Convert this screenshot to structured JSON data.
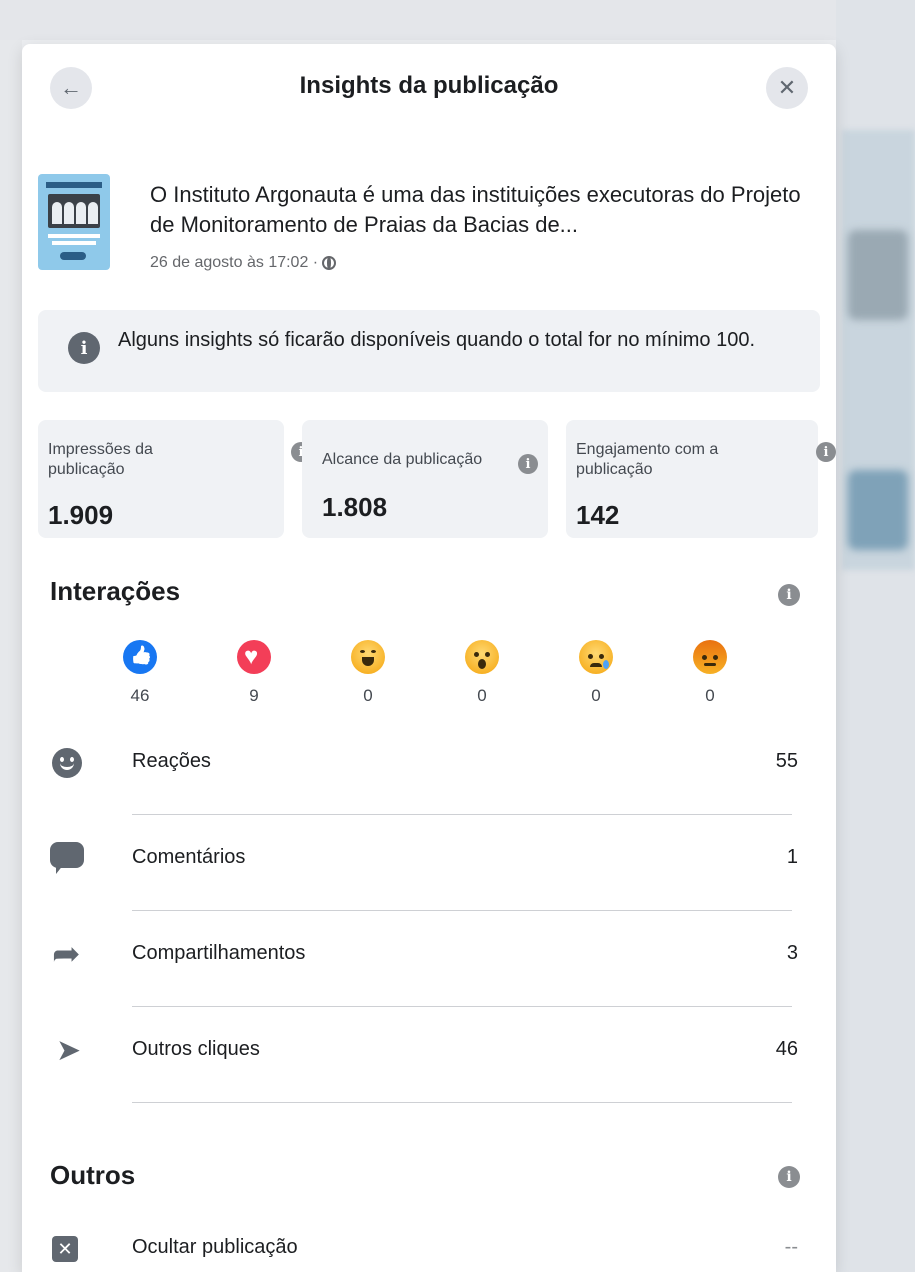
{
  "header": {
    "title": "Insights da publicação",
    "back_icon": "←",
    "close_icon": "✕"
  },
  "post": {
    "text": "O Instituto Argonauta é uma das instituições executoras do Projeto de Monitoramento de Praias da Bacias de...",
    "date": "26 de agosto às 17:02 ·"
  },
  "notice": {
    "text": "Alguns insights só ficarão disponíveis quando o total for no mínimo 100."
  },
  "metrics": [
    {
      "label": "Impressões da publicação",
      "value": "1.909"
    },
    {
      "label": "Alcance da publicação",
      "value": "1.808"
    },
    {
      "label": "Engajamento com a publicação",
      "value": "142"
    }
  ],
  "interactions": {
    "title": "Interações",
    "reactions": [
      {
        "type": "like",
        "icon": "like-icon",
        "count": "46"
      },
      {
        "type": "love",
        "icon": "love-icon",
        "count": "9"
      },
      {
        "type": "haha",
        "icon": "haha-icon",
        "count": "0"
      },
      {
        "type": "wow",
        "icon": "wow-icon",
        "count": "0"
      },
      {
        "type": "sad",
        "icon": "sad-icon",
        "count": "0"
      },
      {
        "type": "angry",
        "icon": "angry-icon",
        "count": "0"
      }
    ],
    "rows": [
      {
        "icon": "smile-icon",
        "label": "Reações",
        "value": "55"
      },
      {
        "icon": "comment-icon",
        "label": "Comentários",
        "value": "1"
      },
      {
        "icon": "share-icon",
        "label": "Compartilhamentos",
        "value": "3"
      },
      {
        "icon": "cursor-icon",
        "label": "Outros cliques",
        "value": "46"
      }
    ]
  },
  "others": {
    "title": "Outros",
    "rows": [
      {
        "icon": "hide-icon",
        "label": "Ocultar publicação",
        "value": "--"
      }
    ]
  },
  "colors": {
    "like": "#1877f2",
    "love": "#f33e58",
    "emoji_yellow": "#f7b125",
    "angry": "#e9710f",
    "icon_gray": "#606770"
  }
}
